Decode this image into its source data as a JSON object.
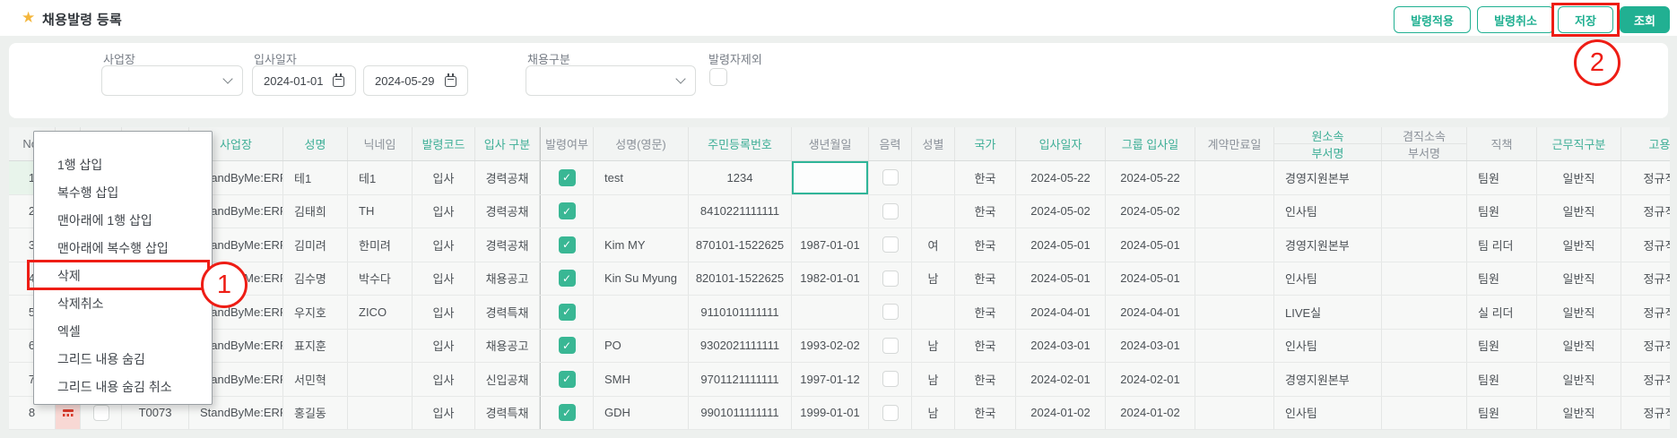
{
  "page": {
    "background": "#edf0ee",
    "accent_teal": "#21b092",
    "annotation_red": "#ee1d15"
  },
  "header": {
    "title": "채용발령 등록",
    "buttons": [
      {
        "label": "발령적용",
        "variant": "outline"
      },
      {
        "label": "발령취소",
        "variant": "outline"
      },
      {
        "label": "저장",
        "variant": "outline",
        "annotated": true
      },
      {
        "label": "조회",
        "variant": "solid"
      }
    ]
  },
  "annotations": {
    "step1": "1",
    "step2": "2"
  },
  "filters": {
    "site": {
      "label": "사업장",
      "value": ""
    },
    "hire_date": {
      "label": "입사일자",
      "from": "2024-01-01",
      "to": "2024-05-29"
    },
    "hire_type": {
      "label": "채용구분",
      "value": ""
    },
    "exclude_ordered": {
      "label": "발령자제외",
      "checked": false
    }
  },
  "context_menu": {
    "items": [
      "1행 삽입",
      "복수행 삽입",
      "맨아래에 1행 삽입",
      "맨아래에 복수행 삽입",
      "삭제",
      "삭제취소",
      "엑셀",
      "그리드 내용 숨김",
      "그리드 내용 숨김 취소"
    ],
    "highlighted_item": "삭제"
  },
  "table": {
    "columns": [
      {
        "key": "no",
        "label": "No.",
        "color": "dark",
        "align": "center"
      },
      {
        "key": "status",
        "label": "",
        "color": "gray",
        "align": "center"
      },
      {
        "key": "select",
        "label": "",
        "color": "gray",
        "align": "center"
      },
      {
        "key": "empno",
        "label": "",
        "color": "teal",
        "align": "center"
      },
      {
        "key": "site",
        "label": "사업장",
        "color": "teal",
        "align": "left"
      },
      {
        "key": "name",
        "label": "성명",
        "color": "teal",
        "align": "left"
      },
      {
        "key": "nickname",
        "label": "닉네임",
        "color": "gray",
        "align": "left"
      },
      {
        "key": "order_code",
        "label": "발령코드",
        "color": "teal",
        "align": "center"
      },
      {
        "key": "hire_type",
        "label": "입사 구분",
        "color": "teal",
        "align": "center"
      },
      {
        "key": "order_done",
        "label": "발령여부",
        "color": "gray",
        "align": "center",
        "type": "check"
      },
      {
        "key": "name_en",
        "label": "성명(영문)",
        "color": "gray",
        "align": "left"
      },
      {
        "key": "rrn",
        "label": "주민등록번호",
        "color": "teal",
        "align": "center"
      },
      {
        "key": "birth",
        "label": "생년월일",
        "color": "gray",
        "align": "center"
      },
      {
        "key": "lunar",
        "label": "음력",
        "color": "gray",
        "align": "center",
        "type": "checkbox"
      },
      {
        "key": "gender",
        "label": "성별",
        "color": "gray",
        "align": "center"
      },
      {
        "key": "country",
        "label": "국가",
        "color": "teal",
        "align": "center"
      },
      {
        "key": "hire_date",
        "label": "입사일자",
        "color": "teal",
        "align": "center"
      },
      {
        "key": "group_hire_date",
        "label": "그룹 입사일",
        "color": "teal",
        "align": "center"
      },
      {
        "key": "contract_end",
        "label": "계약만료일",
        "color": "gray",
        "align": "center"
      },
      {
        "key": "org_dept",
        "label": "원소속",
        "label2": "부서명",
        "color": "teal",
        "align": "left"
      },
      {
        "key": "concurrent_dept",
        "label": "겸직소속",
        "label2": "부서명",
        "color": "gray",
        "align": "left"
      },
      {
        "key": "role",
        "label": "직책",
        "color": "gray",
        "align": "left"
      },
      {
        "key": "work_type",
        "label": "근무직구분",
        "color": "teal",
        "align": "center"
      },
      {
        "key": "emp_type",
        "label": "고용",
        "color": "teal",
        "align": "center"
      }
    ],
    "rows": [
      {
        "no": "1",
        "empno": "",
        "site": "StandByMe:ERP",
        "name": "테1",
        "nickname": "테1",
        "order_code": "입사",
        "hire_type": "경력공채",
        "order_done": true,
        "name_en": "test",
        "rrn": "1234",
        "birth": "",
        "lunar": false,
        "gender": "",
        "country": "한국",
        "hire_date": "2024-05-22",
        "group_hire_date": "2024-05-22",
        "contract_end": "",
        "org_dept": "경영지원본부",
        "concurrent_dept": "",
        "role": "팀원",
        "work_type": "일반직",
        "emp_type": "정규직",
        "highlighted": true,
        "selected_cell": "birth",
        "modified": false,
        "show_select": false
      },
      {
        "no": "2",
        "empno": "",
        "site": "StandByMe:ERP",
        "name": "김태희",
        "nickname": "TH",
        "order_code": "입사",
        "hire_type": "경력공채",
        "order_done": true,
        "name_en": "",
        "rrn": "8410221111111",
        "birth": "",
        "lunar": false,
        "gender": "",
        "country": "한국",
        "hire_date": "2024-05-02",
        "group_hire_date": "2024-05-02",
        "contract_end": "",
        "org_dept": "인사팀",
        "concurrent_dept": "",
        "role": "팀원",
        "work_type": "일반직",
        "emp_type": "정규직",
        "highlighted": false,
        "selected_cell": "",
        "modified": false,
        "show_select": false
      },
      {
        "no": "3",
        "empno": "",
        "site": "StandByMe:ERP",
        "name": "김미려",
        "nickname": "한미려",
        "order_code": "입사",
        "hire_type": "경력공채",
        "order_done": true,
        "name_en": "Kim MY",
        "rrn": "870101-1522625",
        "birth": "1987-01-01",
        "lunar": false,
        "gender": "여",
        "country": "한국",
        "hire_date": "2024-05-01",
        "group_hire_date": "2024-05-01",
        "contract_end": "",
        "org_dept": "경영지원본부",
        "concurrent_dept": "",
        "role": "팀 리더",
        "work_type": "일반직",
        "emp_type": "정규직",
        "highlighted": false,
        "selected_cell": "",
        "modified": false,
        "show_select": false
      },
      {
        "no": "4",
        "empno": "",
        "site": "StandByMe:ERP",
        "name": "김수명",
        "nickname": "박수다",
        "order_code": "입사",
        "hire_type": "채용공고",
        "order_done": true,
        "name_en": "Kin Su Myung",
        "rrn": "820101-1522625",
        "birth": "1982-01-01",
        "lunar": false,
        "gender": "남",
        "country": "한국",
        "hire_date": "2024-05-01",
        "group_hire_date": "2024-05-01",
        "contract_end": "",
        "org_dept": "인사팀",
        "concurrent_dept": "",
        "role": "팀원",
        "work_type": "일반직",
        "emp_type": "정규직",
        "highlighted": false,
        "selected_cell": "",
        "modified": false,
        "show_select": false
      },
      {
        "no": "5",
        "empno": "",
        "site": "StandByMe:ERP",
        "name": "우지호",
        "nickname": "ZICO",
        "order_code": "입사",
        "hire_type": "경력특채",
        "order_done": true,
        "name_en": "",
        "rrn": "9110101111111",
        "birth": "",
        "lunar": false,
        "gender": "",
        "country": "한국",
        "hire_date": "2024-04-01",
        "group_hire_date": "2024-04-01",
        "contract_end": "",
        "org_dept": "LIVE실",
        "concurrent_dept": "",
        "role": "실 리더",
        "work_type": "일반직",
        "emp_type": "정규직",
        "highlighted": false,
        "selected_cell": "",
        "modified": false,
        "show_select": false
      },
      {
        "no": "6",
        "empno": "",
        "site": "StandByMe:ERP",
        "name": "표지훈",
        "nickname": "",
        "order_code": "입사",
        "hire_type": "채용공고",
        "order_done": true,
        "name_en": "PO",
        "rrn": "9302021111111",
        "birth": "1993-02-02",
        "lunar": false,
        "gender": "남",
        "country": "한국",
        "hire_date": "2024-03-01",
        "group_hire_date": "2024-03-01",
        "contract_end": "",
        "org_dept": "인사팀",
        "concurrent_dept": "",
        "role": "팀원",
        "work_type": "일반직",
        "emp_type": "정규직",
        "highlighted": false,
        "selected_cell": "",
        "modified": false,
        "show_select": false
      },
      {
        "no": "7",
        "empno": "",
        "site": "StandByMe:ERP",
        "name": "서민혁",
        "nickname": "",
        "order_code": "입사",
        "hire_type": "신입공채",
        "order_done": true,
        "name_en": "SMH",
        "rrn": "9701121111111",
        "birth": "1997-01-12",
        "lunar": false,
        "gender": "남",
        "country": "한국",
        "hire_date": "2024-02-01",
        "group_hire_date": "2024-02-01",
        "contract_end": "",
        "org_dept": "경영지원본부",
        "concurrent_dept": "",
        "role": "팀원",
        "work_type": "일반직",
        "emp_type": "정규직",
        "highlighted": false,
        "selected_cell": "",
        "modified": false,
        "show_select": false
      },
      {
        "no": "8",
        "empno": "T0073",
        "site": "StandByMe:ERP",
        "name": "홍길동",
        "nickname": "",
        "order_code": "입사",
        "hire_type": "경력특채",
        "order_done": true,
        "name_en": "GDH",
        "rrn": "9901011111111",
        "birth": "1999-01-01",
        "lunar": false,
        "gender": "남",
        "country": "한국",
        "hire_date": "2024-01-02",
        "group_hire_date": "2024-01-02",
        "contract_end": "",
        "org_dept": "인사팀",
        "concurrent_dept": "",
        "role": "팀원",
        "work_type": "일반직",
        "emp_type": "정규직",
        "highlighted": false,
        "selected_cell": "",
        "modified": true,
        "show_select": true
      }
    ]
  }
}
